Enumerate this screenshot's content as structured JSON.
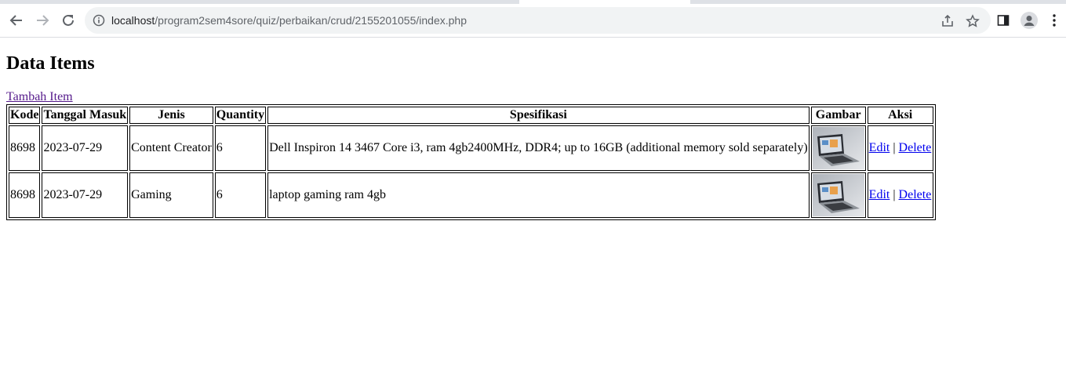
{
  "browser": {
    "url_host": "localhost",
    "url_path": "/program2sem4sore/quiz/perbaikan/crud/2155201055/index.php"
  },
  "page": {
    "title": "Data Items",
    "add_link": "Tambah Item"
  },
  "table": {
    "headers": [
      "Kode",
      "Tanggal Masuk",
      "Jenis",
      "Quantity",
      "Spesifikasi",
      "Gambar",
      "Aksi"
    ],
    "rows": [
      {
        "kode": "8698",
        "tanggal": "2023-07-29",
        "jenis": "Content Creator",
        "quantity": "6",
        "spesifikasi": "Dell Inspiron 14 3467 Core i3, ram 4gb2400MHz, DDR4; up to 16GB (additional memory sold separately)",
        "gambar": "laptop-image",
        "edit": "Edit",
        "separator": "|",
        "delete": "Delete"
      },
      {
        "kode": "8698",
        "tanggal": "2023-07-29",
        "jenis": "Gaming",
        "quantity": "6",
        "spesifikasi": "laptop gaming ram 4gb",
        "gambar": "laptop-image",
        "edit": "Edit",
        "separator": "|",
        "delete": "Delete"
      }
    ]
  }
}
